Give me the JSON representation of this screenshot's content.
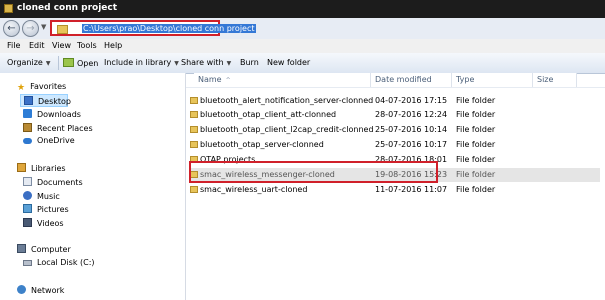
{
  "window": {
    "title": "cloned conn project"
  },
  "address": {
    "path": "C:\\Users\\prao\\Desktop\\cloned conn project"
  },
  "menu": [
    "File",
    "Edit",
    "View",
    "Tools",
    "Help"
  ],
  "toolbar": {
    "organize": "Organize",
    "open": "Open",
    "include": "Include in library",
    "share": "Share with",
    "burn": "Burn",
    "new_folder": "New folder"
  },
  "nav": {
    "favorites": "Favorites",
    "desktop": "Desktop",
    "downloads": "Downloads",
    "recent": "Recent Places",
    "onedrive": "OneDrive",
    "libraries": "Libraries",
    "documents": "Documents",
    "music": "Music",
    "pictures": "Pictures",
    "videos": "Videos",
    "computer": "Computer",
    "local_disk": "Local Disk (C:)",
    "network": "Network"
  },
  "columns": {
    "name": "Name",
    "date": "Date modified",
    "type": "Type",
    "size": "Size"
  },
  "files": [
    {
      "name": "bluetooth_alert_notification_server-clonned",
      "date": "04-07-2016 17:15",
      "type": "File folder"
    },
    {
      "name": "bluetooth_otap_client_att-clonned",
      "date": "28-07-2016 12:24",
      "type": "File folder"
    },
    {
      "name": "bluetooth_otap_client_l2cap_credit-clonned",
      "date": "25-07-2016 10:14",
      "type": "File folder"
    },
    {
      "name": "bluetooth_otap_server-clonned",
      "date": "25-07-2016 10:17",
      "type": "File folder"
    },
    {
      "name": "OTAP projects",
      "date": "28-07-2016 18:01",
      "type": "File folder"
    },
    {
      "name": "smac_wireless_messenger-cloned",
      "date": "19-08-2016 15:23",
      "type": "File folder"
    },
    {
      "name": "smac_wireless_uart-cloned",
      "date": "11-07-2016 11:07",
      "type": "File folder"
    }
  ]
}
